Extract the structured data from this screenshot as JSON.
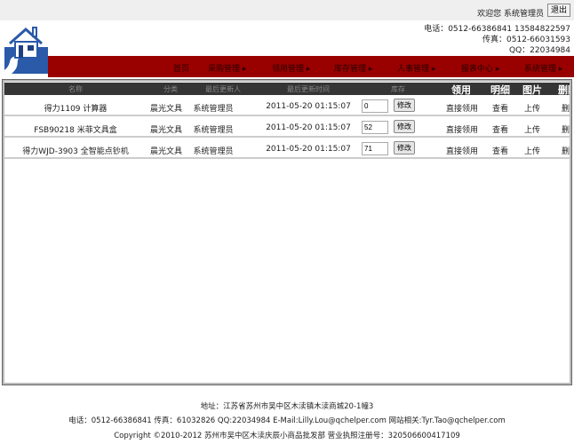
{
  "header": {
    "welcome": "欢迎您 系统管理员",
    "logout": "退出",
    "phone": "电话：0512-66386841 13584822597",
    "fax": "传真：0512-66031593",
    "qq": "QQ：22034984"
  },
  "nav": [
    "首页",
    "采购管理 ▸",
    "领用管理 ▸",
    "库存管理 ▸",
    "人事管理 ▸",
    "报表中心 ▸",
    "系统管理 ▸"
  ],
  "table": {
    "columns": [
      "名称",
      "分类",
      "最后更新人",
      "最后更新时间",
      "库存",
      "领用",
      "明细",
      "图片",
      "删除"
    ],
    "rows": [
      {
        "name": "得力1109 计算器",
        "category": "晨光文具",
        "updater": "系统管理员",
        "time": "2011-05-20 01:15:07",
        "stock": "0",
        "edit": "修改",
        "use": "直接领用",
        "detail": "查看",
        "image": "上传",
        "delete": "删除"
      },
      {
        "name": "FSB90218 米菲文具盒",
        "category": "晨光文具",
        "updater": "系统管理员",
        "time": "2011-05-20 01:15:07",
        "stock": "52",
        "edit": "修改",
        "use": "直接领用",
        "detail": "查看",
        "image": "上传",
        "delete": "删除"
      },
      {
        "name": "得力WJD-3903 全智能点钞机",
        "category": "晨光文具",
        "updater": "系统管理员",
        "time": "2011-05-20 01:15:07",
        "stock": "71",
        "edit": "修改",
        "use": "直接领用",
        "detail": "查看",
        "image": "上传",
        "delete": "删除"
      }
    ]
  },
  "footer": {
    "address": "地址：江苏省苏州市吴中区木渎镇木渎商城20-1幢3",
    "contact": "电话：0512-66386841 传真：61032826 QQ:22034984 E-Mail:Lilly.Lou@qchelper.com 网站相关:Tyr.Tao@qchelper.com",
    "copyright": "Copyright ©2010-2012 苏州市吴中区木渎庆辰小商品批发部 营业执照注册号：320506600417109"
  }
}
